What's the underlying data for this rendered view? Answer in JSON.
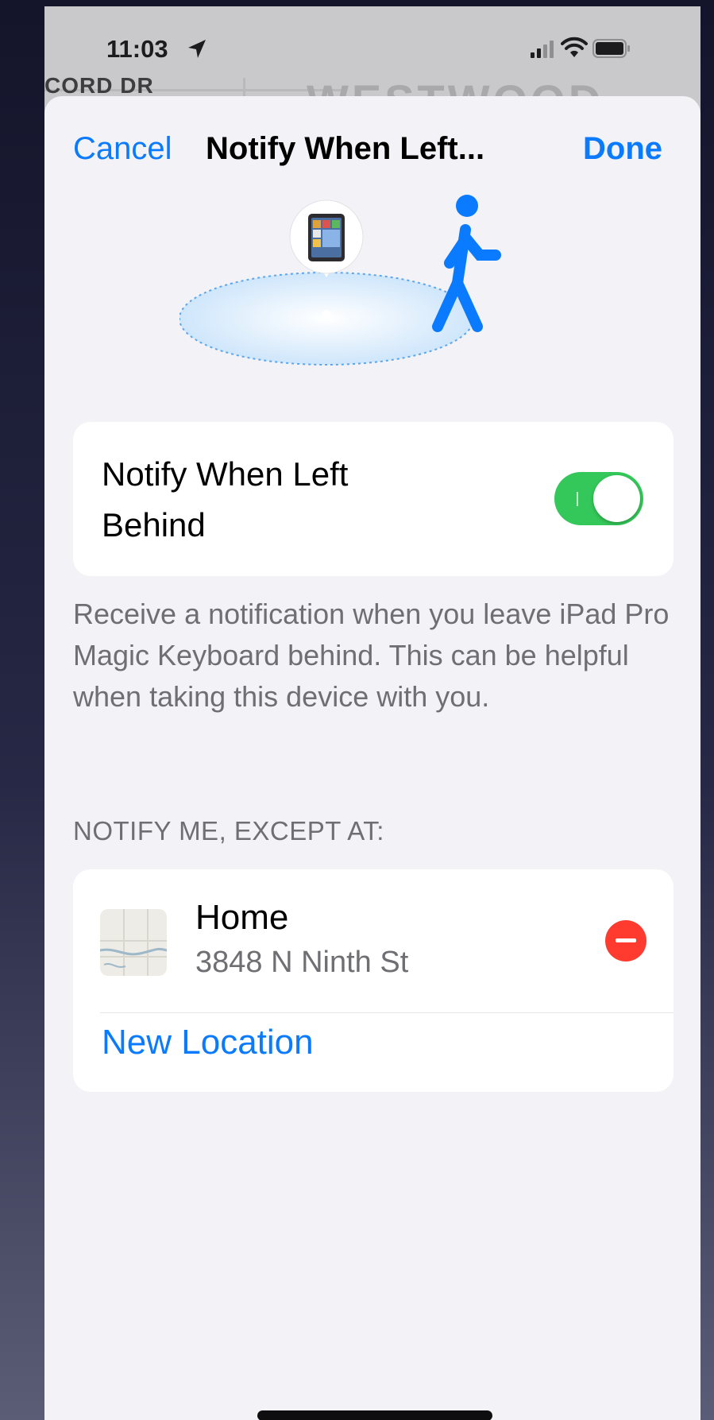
{
  "status_bar": {
    "time": "11:03",
    "icons": [
      "location-arrow-icon",
      "cellular-signal-icon",
      "wifi-icon",
      "battery-icon"
    ]
  },
  "background_map": {
    "street_label": "CORD DR",
    "area_label": "WESTWOOD"
  },
  "nav": {
    "cancel_label": "Cancel",
    "title": "Notify When Left...",
    "done_label": "Done"
  },
  "toggle": {
    "label": "Notify When Left Behind",
    "enabled": true
  },
  "description": "Receive a notification when you leave iPad Pro Magic Keyboard behind. This can be helpful when taking this device with you.",
  "exceptions": {
    "header": "NOTIFY ME, EXCEPT AT:",
    "locations": [
      {
        "name": "Home",
        "address": "3848 N Ninth St"
      }
    ],
    "add_label": "New Location"
  },
  "colors": {
    "accent": "#0a7aff",
    "toggle_on": "#34c759",
    "destructive": "#ff3b30",
    "background": "#f2f2f7",
    "secondary_text": "#6e6e73"
  }
}
